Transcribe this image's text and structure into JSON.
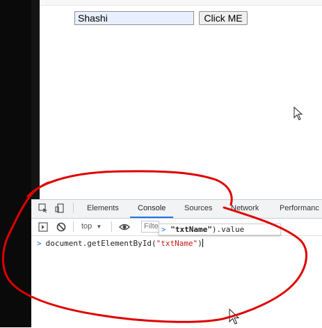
{
  "page": {
    "name_input_value": "Shashi",
    "button_label": "Click ME"
  },
  "devtools": {
    "tabs": [
      "Elements",
      "Console",
      "Sources",
      "Network",
      "Performanc"
    ],
    "active_tab": "Console",
    "context_label": "top",
    "filter_text": "Filte",
    "autocomplete": {
      "prompt": ">",
      "string_part": "\"txtName\"",
      "rest": ").value"
    },
    "console_input": {
      "prompt": ">",
      "prefix": "document.getElementById(",
      "string": "\"txtName\"",
      "suffix": ")"
    }
  },
  "colors": {
    "accent": "#1a73e8",
    "annotation": "#e00000",
    "string": "#c41a16"
  }
}
